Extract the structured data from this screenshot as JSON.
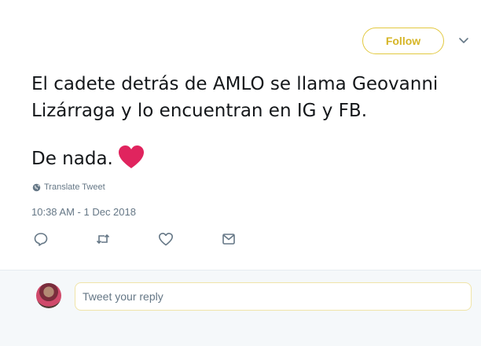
{
  "header": {
    "follow_label": "Follow"
  },
  "tweet": {
    "lines": [
      "El cadete detrás de AMLO se llama Geovanni",
      "Lizárraga y lo encuentran en IG y FB.",
      "De nada."
    ],
    "translate_label": "Translate Tweet",
    "timestamp": "10:38 AM - 1 Dec 2018"
  },
  "actions": [
    "reply-icon",
    "retweet-icon",
    "like-icon",
    "direct-message-icon"
  ],
  "reply": {
    "placeholder": "Tweet your reply"
  },
  "colors": {
    "accent": "#d6b526",
    "heart": "#e0245e",
    "muted": "#657786"
  }
}
